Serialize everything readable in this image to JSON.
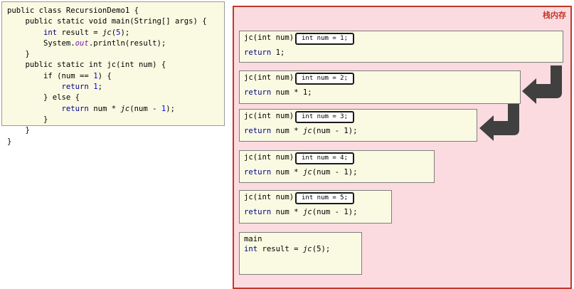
{
  "code": {
    "lines": [
      [
        {
          "t": "public class RecursionDemo1 {",
          "c": ""
        }
      ],
      [
        {
          "t": "    public static void main(String[] args) {",
          "c": ""
        }
      ],
      [
        {
          "t": "        ",
          "c": ""
        },
        {
          "t": "int",
          "c": "kw"
        },
        {
          "t": " result = ",
          "c": ""
        },
        {
          "t": "jc",
          "c": "it"
        },
        {
          "t": "(",
          "c": ""
        },
        {
          "t": "5",
          "c": "num"
        },
        {
          "t": ");",
          "c": ""
        }
      ],
      [
        {
          "t": "        System.",
          "c": ""
        },
        {
          "t": "out",
          "c": "field"
        },
        {
          "t": ".println(result);",
          "c": ""
        }
      ],
      [
        {
          "t": "    }",
          "c": ""
        }
      ],
      [
        {
          "t": "    public static int jc(int num) {",
          "c": ""
        }
      ],
      [
        {
          "t": "        if (num == ",
          "c": ""
        },
        {
          "t": "1",
          "c": "num"
        },
        {
          "t": ") {",
          "c": ""
        }
      ],
      [
        {
          "t": "            ",
          "c": ""
        },
        {
          "t": "return",
          "c": "kw"
        },
        {
          "t": " ",
          "c": ""
        },
        {
          "t": "1",
          "c": "num"
        },
        {
          "t": ";",
          "c": ""
        }
      ],
      [
        {
          "t": "        } else {",
          "c": ""
        }
      ],
      [
        {
          "t": "            ",
          "c": ""
        },
        {
          "t": "return",
          "c": "kw"
        },
        {
          "t": " num * ",
          "c": ""
        },
        {
          "t": "jc",
          "c": "it"
        },
        {
          "t": "(num - ",
          "c": ""
        },
        {
          "t": "1",
          "c": "num"
        },
        {
          "t": ");",
          "c": ""
        }
      ],
      [
        {
          "t": "        }",
          "c": ""
        }
      ],
      [
        {
          "t": "    }",
          "c": ""
        }
      ],
      [
        {
          "t": "}",
          "c": ""
        }
      ]
    ]
  },
  "stack": {
    "title": "栈内存",
    "frames": [
      {
        "sig": "jc(int num)",
        "var": "int num = 1;",
        "body_parts": [
          {
            "t": "return",
            "c": "ret"
          },
          {
            "t": " 1;",
            "c": ""
          }
        ]
      },
      {
        "sig": "jc(int num)",
        "var": "int num = 2;",
        "body_parts": [
          {
            "t": "return",
            "c": "ret"
          },
          {
            "t": " num * 1;",
            "c": ""
          }
        ]
      },
      {
        "sig": "jc(int num)",
        "var": "int num = 3;",
        "body_parts": [
          {
            "t": "return",
            "c": "ret"
          },
          {
            "t": " num * ",
            "c": ""
          },
          {
            "t": "jc",
            "c": "it"
          },
          {
            "t": "(num - 1);",
            "c": ""
          }
        ]
      },
      {
        "sig": "jc(int num)",
        "var": "int num = 4;",
        "body_parts": [
          {
            "t": "return",
            "c": "ret"
          },
          {
            "t": " num * ",
            "c": ""
          },
          {
            "t": "jc",
            "c": "it"
          },
          {
            "t": "(num - 1);",
            "c": ""
          }
        ]
      },
      {
        "sig": "jc(int num)",
        "var": "int num = 5;",
        "body_parts": [
          {
            "t": "return",
            "c": "ret"
          },
          {
            "t": " num * ",
            "c": ""
          },
          {
            "t": "jc",
            "c": "it"
          },
          {
            "t": "(num - 1);",
            "c": ""
          }
        ]
      }
    ],
    "main": {
      "sig": "main",
      "body_parts": [
        {
          "t": "int",
          "c": "ret"
        },
        {
          "t": " result = ",
          "c": ""
        },
        {
          "t": "jc",
          "c": "it"
        },
        {
          "t": "(5);",
          "c": ""
        }
      ]
    }
  },
  "colors": {
    "arrow": "#404040",
    "panel_border": "#c0392b",
    "stack_bg": "#fbdbe0",
    "frame_bg": "#fafae3"
  }
}
